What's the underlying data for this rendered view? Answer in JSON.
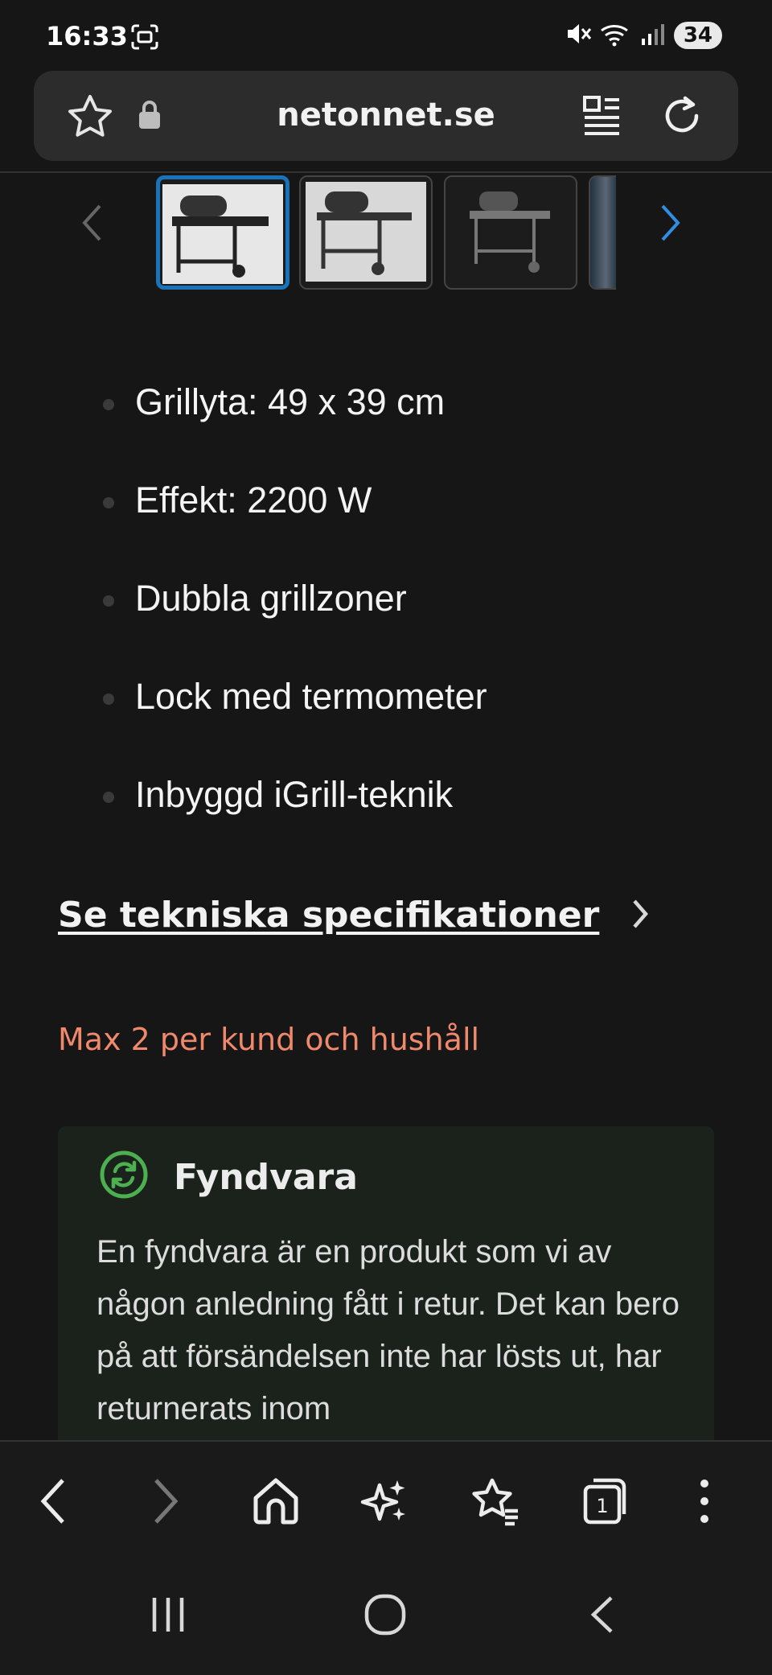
{
  "status_bar": {
    "time": "16:33",
    "battery": "34",
    "icons": [
      "screenshot-icon",
      "mute-icon",
      "wifi-icon",
      "signal-icon"
    ]
  },
  "browser": {
    "url": "netonnet.se",
    "icons": [
      "bookmark-star-icon",
      "lock-icon",
      "reader-mode-icon",
      "reload-icon"
    ]
  },
  "gallery": {
    "selected_index": 0,
    "accent_color": "#1a73b8"
  },
  "features": [
    "Grillyta: 49 x 39 cm",
    "Effekt: 2200 W",
    "Dubbla grillzoner",
    "Lock med termometer",
    "Inbyggd iGrill-teknik"
  ],
  "spec_link": "Se tekniska specifikationer",
  "limit_note": "Max 2 per kund och hushåll",
  "limit_note_color": "#f0886b",
  "fyndvara": {
    "title": "Fyndvara",
    "text": "En fyndvara är en produkt som vi av någon anledning fått i retur. Det kan bero på att försändelsen inte har lösts ut, har returnerats inom",
    "icon": "recycle-icon",
    "icon_color": "#4caf50"
  },
  "bottom_nav": {
    "tab_count": "1",
    "icons": [
      "back-icon",
      "forward-icon",
      "home-icon",
      "ai-sparkle-icon",
      "favorites-icon",
      "tabs-icon",
      "menu-icon"
    ]
  },
  "system_nav": {
    "icons": [
      "recents-icon",
      "home-icon",
      "back-icon"
    ]
  }
}
